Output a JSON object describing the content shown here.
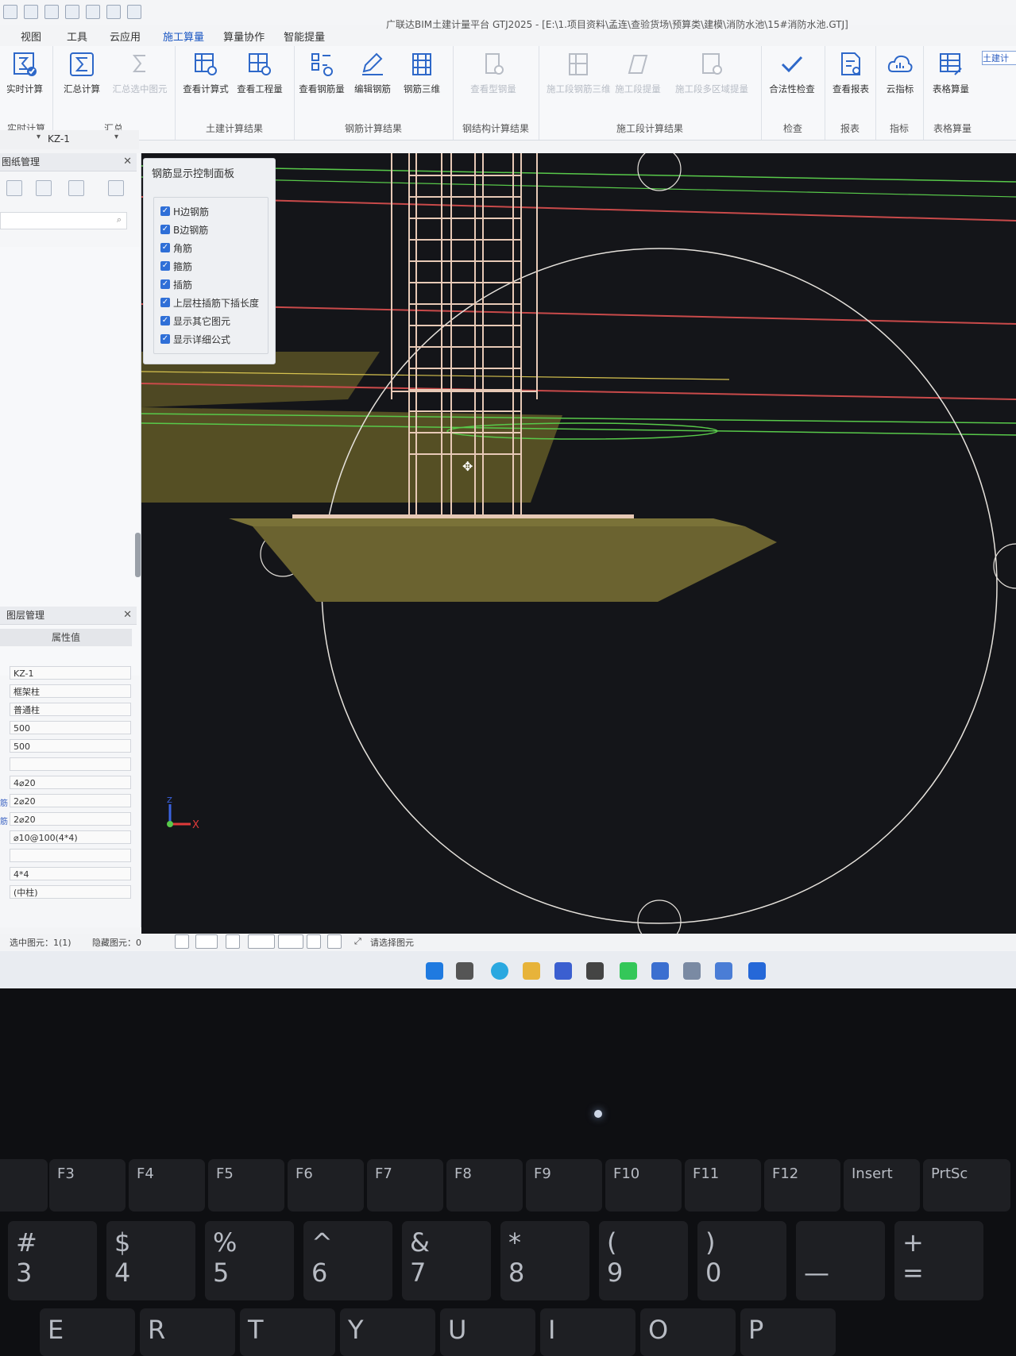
{
  "window": {
    "title": "广联达BIM土建计量平台 GTJ2025 - [E:\\1.项目资料\\孟连\\查验货场\\预算类\\建模\\消防水池\\15#消防水池.GTJ]"
  },
  "menu": {
    "items": [
      "视图",
      "工具",
      "云应用",
      "施工算量",
      "算量协作",
      "智能提量"
    ]
  },
  "ribbon": {
    "groups": [
      {
        "label": "实时计算",
        "buttons": [
          "实时计算"
        ]
      },
      {
        "label": "汇总",
        "buttons": [
          "汇总计算",
          "汇总选中图元"
        ]
      },
      {
        "label": "土建计算结果",
        "buttons": [
          "查看计算式",
          "查看工程量"
        ]
      },
      {
        "label": "钢筋计算结果",
        "buttons": [
          "查看钢筋量",
          "编辑钢筋",
          "钢筋三维"
        ]
      },
      {
        "label": "钢结构计算结果",
        "buttons": [
          "查看型钢量"
        ]
      },
      {
        "label": "施工段计算结果",
        "buttons": [
          "施工段钢筋三维",
          "施工段提量",
          "施工段多区域提量"
        ]
      },
      {
        "label": "检查",
        "buttons": [
          "合法性检查"
        ]
      },
      {
        "label": "报表",
        "buttons": [
          "查看报表"
        ]
      },
      {
        "label": "指标",
        "buttons": [
          "云指标"
        ]
      },
      {
        "label": "表格算量",
        "buttons": [
          "表格算量"
        ]
      }
    ],
    "far_right_label": "土建计"
  },
  "selector": {
    "value": "KZ-1"
  },
  "panels": {
    "drawing_title": "图纸管理",
    "layer_title": "图层管理",
    "attr_header": "属性值",
    "attr_values": [
      "KZ-1",
      "框架柱",
      "普通柱",
      "500",
      "500",
      "",
      "4⌀20",
      "2⌀20",
      "2⌀20",
      "⌀10@100(4*4)",
      "",
      "4*4",
      "(中柱)"
    ],
    "attr_tags": [
      "筋",
      "筋"
    ]
  },
  "rebar_panel": {
    "title": "钢筋显示控制面板",
    "items": [
      "H边钢筋",
      "B边钢筋",
      "角筋",
      "箍筋",
      "插筋",
      "上层柱插筋下插长度",
      "显示其它图元",
      "显示详细公式"
    ]
  },
  "viewport": {
    "axis_x": "X",
    "axis_z": "Z"
  },
  "statusbar": {
    "selected": "选中图元：1(1)",
    "hidden": "隐藏图元：0",
    "hint": "请选择图元"
  },
  "keyboard": {
    "fn_row": [
      "F3",
      "F4",
      "F5",
      "F6",
      "F7",
      "F8",
      "F9",
      "F10",
      "F11",
      "F12",
      "Insert",
      "PrtSc"
    ],
    "num_row_top": [
      "#",
      "$",
      "%",
      "^",
      "&",
      "*",
      "(",
      ")",
      "",
      "+"
    ],
    "num_row_bottom": [
      "3",
      "4",
      "5",
      "6",
      "7",
      "8",
      "9",
      "0",
      "—",
      "="
    ],
    "letter_row": [
      "E",
      "R",
      "T",
      "Y",
      "U",
      "I",
      "O",
      "P"
    ]
  },
  "colors": {
    "accent": "#1a56c2",
    "viewport_bg": "#141519",
    "footing": "#6b6330",
    "rebar": "#e7c9b6",
    "axis_red": "#c94a4a",
    "axis_green": "#58c94a"
  }
}
